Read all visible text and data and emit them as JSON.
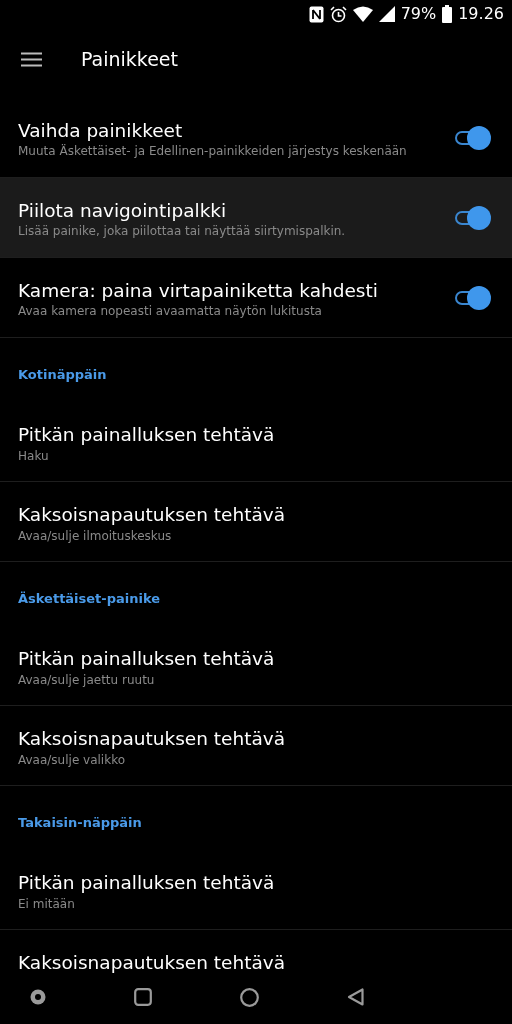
{
  "status_bar": {
    "battery": "79%",
    "time": "19.26"
  },
  "app_bar": {
    "title": "Painikkeet"
  },
  "toggles": [
    {
      "title": "Vaihda painikkeet",
      "subtitle": "Muuta Äskettäiset- ja Edellinen-painikkeiden järjestys keskenään",
      "on": true,
      "selected": false
    },
    {
      "title": "Piilota navigointipalkki",
      "subtitle": "Lisää painike, joka piilottaa tai näyttää siirtymispalkin.",
      "on": true,
      "selected": true
    },
    {
      "title": "Kamera: paina virtapainiketta kahdesti",
      "subtitle": "Avaa kamera nopeasti avaamatta näytön lukitusta",
      "on": true,
      "selected": false
    }
  ],
  "sections": [
    {
      "header": "Kotinäppäin",
      "items": [
        {
          "title": "Pitkän painalluksen tehtävä",
          "subtitle": "Haku"
        },
        {
          "title": "Kaksoisnapautuksen tehtävä",
          "subtitle": "Avaa/sulje ilmoituskeskus"
        }
      ]
    },
    {
      "header": "Äskettäiset-painike",
      "items": [
        {
          "title": "Pitkän painalluksen tehtävä",
          "subtitle": "Avaa/sulje jaettu ruutu"
        },
        {
          "title": "Kaksoisnapautuksen tehtävä",
          "subtitle": "Avaa/sulje valikko"
        }
      ]
    },
    {
      "header": "Takaisin-näppäin",
      "items": [
        {
          "title": "Pitkän painalluksen tehtävä",
          "subtitle": "Ei mitään"
        },
        {
          "title": "Kaksoisnapautuksen tehtävä"
        }
      ]
    }
  ]
}
